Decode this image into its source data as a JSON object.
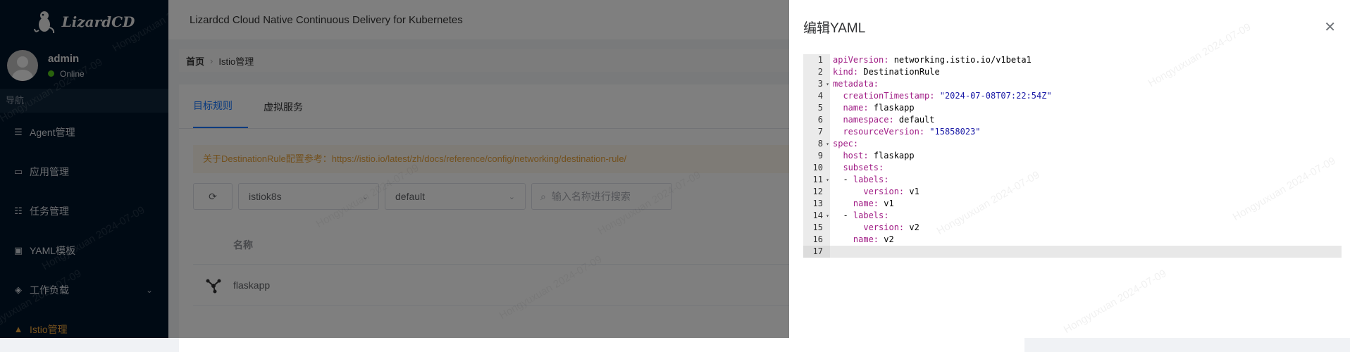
{
  "app": {
    "logo_text": "LizardCD",
    "header_title": "Lizardcd Cloud Native Continuous Delivery for Kubernetes"
  },
  "user": {
    "name": "admin",
    "status": "Online"
  },
  "sidebar": {
    "nav_header": "导航",
    "items": [
      {
        "label": "Agent管理",
        "icon": "sliders-icon"
      },
      {
        "label": "应用管理",
        "icon": "monitor-icon"
      },
      {
        "label": "任务管理",
        "icon": "list-icon"
      },
      {
        "label": "YAML模板",
        "icon": "template-icon"
      },
      {
        "label": "工作负载",
        "icon": "layers-icon",
        "has_submenu": true
      },
      {
        "label": "Istio管理",
        "icon": "istio-sail-icon",
        "active": true
      }
    ]
  },
  "breadcrumb": {
    "home": "首页",
    "current": "Istio管理"
  },
  "tabs": [
    {
      "label": "目标规则",
      "active": true
    },
    {
      "label": "虚拟服务"
    }
  ],
  "alert": {
    "text": "关于DestinationRule配置参考：https://istio.io/latest/zh/docs/reference/config/networking/destination-rule/"
  },
  "filters": {
    "cluster": "istiok8s",
    "namespace": "default",
    "search_placeholder": "输入名称进行搜索"
  },
  "table": {
    "columns": [
      "名称"
    ],
    "rows": [
      {
        "name": "flaskapp"
      }
    ]
  },
  "drawer": {
    "title": "编辑YAML",
    "lines": [
      "apiVersion: networking.istio.io/v1beta1",
      "kind: DestinationRule",
      "metadata:",
      "  creationTimestamp: \"2024-07-08T07:22:54Z\"",
      "  name: flaskapp",
      "  namespace: default",
      "  resourceVersion: \"15858023\"",
      "spec:",
      "  host: flaskapp",
      "  subsets:",
      "  - labels:",
      "      version: v1",
      "    name: v1",
      "  - labels:",
      "      version: v2",
      "    name: v2",
      ""
    ],
    "fold_lines": [
      3,
      8,
      11,
      14
    ],
    "current_line": 17
  },
  "watermark": "Hongyuxuan 2024-07-09",
  "colors": {
    "sidebar_bg": "#001529",
    "active_nav": "#e6a23c",
    "primary": "#1677ff",
    "yaml_key": "#a01c85",
    "yaml_string": "#1a1aa6"
  }
}
